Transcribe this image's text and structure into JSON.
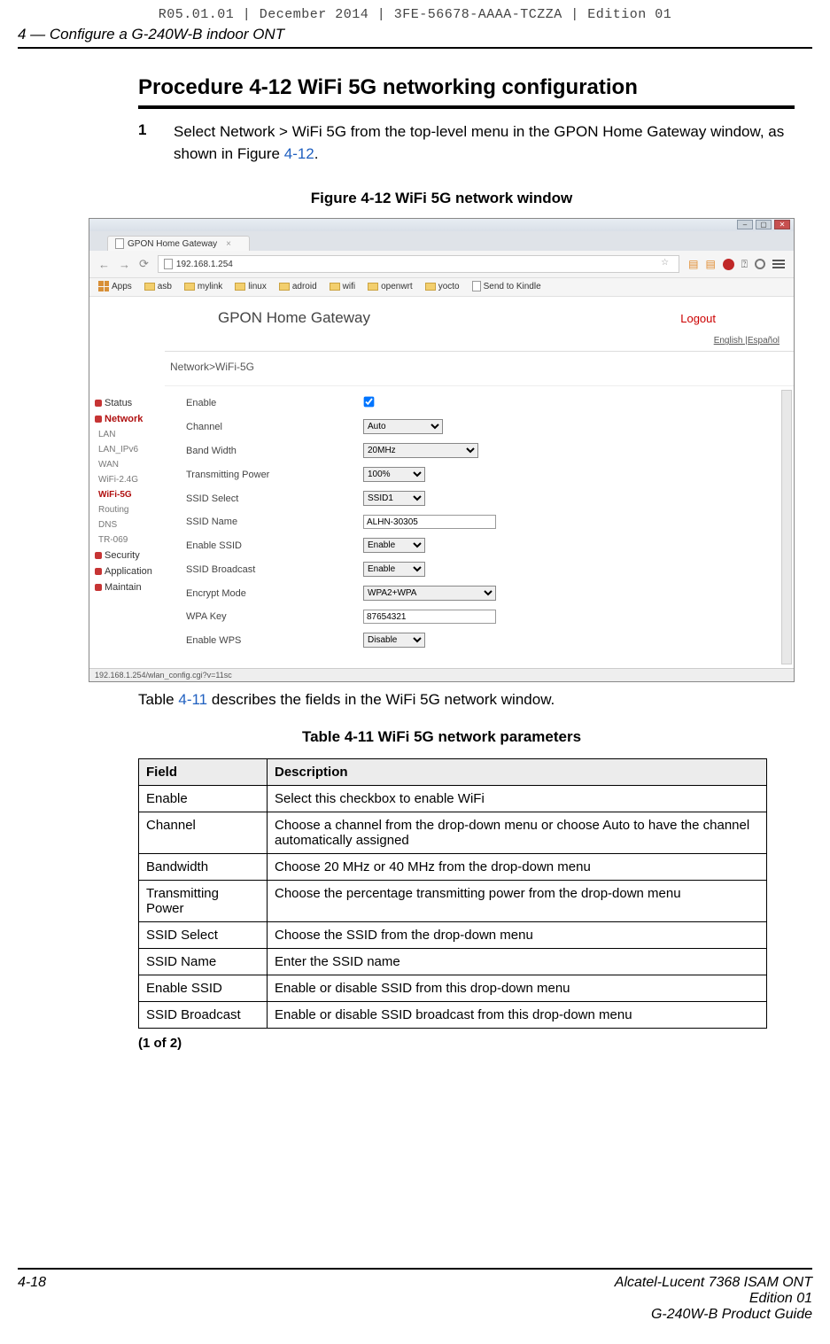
{
  "draft_banner": "R05.01.01 | December 2014 | 3FE-56678-AAAA-TCZZA | Edition 01",
  "header": {
    "left": "4 —  Configure a G-240W-B indoor ONT"
  },
  "procedure_title": "Procedure 4-12  WiFi 5G networking configuration",
  "step1": {
    "num": "1",
    "text_before": "Select Network > WiFi 5G from the top-level menu in the GPON Home Gateway window, as shown in Figure ",
    "link": "4-12",
    "text_after": "."
  },
  "figure_caption": "Figure 4-12  WiFi 5G network window",
  "browser": {
    "tab_title": "GPON Home Gateway",
    "address": "192.168.1.254",
    "bookmarks_label_apps": "Apps",
    "bookmarks": [
      "asb",
      "mylink",
      "linux",
      "adroid",
      "wifi",
      "openwrt",
      "yocto"
    ],
    "bookmark_action": "Send to Kindle",
    "status_bar": "192.168.1.254/wlan_config.cgi?v=11sc"
  },
  "gateway": {
    "title": "GPON Home Gateway",
    "logout": "Logout",
    "lang": "English |Español",
    "breadcrumb": "Network>WiFi-5G",
    "sidebar": {
      "status": "Status",
      "network": "Network",
      "subs": [
        "LAN",
        "LAN_IPv6",
        "WAN",
        "WiFi-2.4G",
        "WiFi-5G",
        "Routing",
        "DNS",
        "TR-069"
      ],
      "security": "Security",
      "application": "Application",
      "maintain": "Maintain"
    },
    "fields": {
      "enable_lbl": "Enable",
      "channel_lbl": "Channel",
      "channel_val": "Auto",
      "bw_lbl": "Band Width",
      "bw_val": "20MHz",
      "tx_lbl": "Transmitting Power",
      "tx_val": "100%",
      "ssidsel_lbl": "SSID Select",
      "ssidsel_val": "SSID1",
      "ssidname_lbl": "SSID Name",
      "ssidname_val": "ALHN-30305",
      "enablessid_lbl": "Enable SSID",
      "enablessid_val": "Enable",
      "ssidbc_lbl": "SSID Broadcast",
      "ssidbc_val": "Enable",
      "enc_lbl": "Encrypt Mode",
      "enc_val": "WPA2+WPA",
      "wpakey_lbl": "WPA Key",
      "wpakey_val": "87654321",
      "wps_lbl": "Enable WPS",
      "wps_val": "Disable"
    }
  },
  "inter_text_before": "Table ",
  "inter_link": "4-11",
  "inter_text_after": " describes the fields in the WiFi 5G network window.",
  "table_caption": "Table 4-11 WiFi 5G network parameters",
  "table_headers": {
    "field": "Field",
    "desc": "Description"
  },
  "table_rows": [
    {
      "f": "Enable",
      "d": "Select this checkbox to enable WiFi"
    },
    {
      "f": "Channel",
      "d": "Choose a channel from the drop-down menu or choose Auto to have the channel automatically assigned"
    },
    {
      "f": "Bandwidth",
      "d": "Choose 20 MHz or 40 MHz from the drop-down menu"
    },
    {
      "f": "Transmitting Power",
      "d": "Choose the percentage transmitting power from the drop-down menu"
    },
    {
      "f": "SSID Select",
      "d": "Choose the SSID from the drop-down menu"
    },
    {
      "f": "SSID Name",
      "d": "Enter the SSID name"
    },
    {
      "f": "Enable SSID",
      "d": "Enable or disable SSID from this drop-down menu"
    },
    {
      "f": "SSID Broadcast",
      "d": "Enable or disable SSID broadcast from this drop-down menu"
    }
  ],
  "continuation": "(1 of 2)",
  "footer": {
    "page_num": "4-18",
    "line1": "Alcatel-Lucent 7368 ISAM ONT",
    "line2": "Edition 01",
    "line3": "G-240W-B Product Guide"
  }
}
